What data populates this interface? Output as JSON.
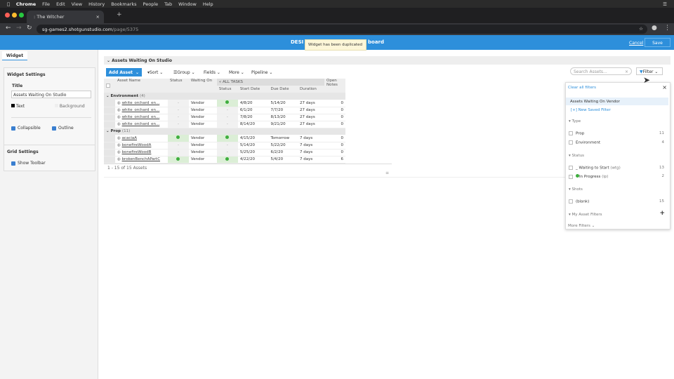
{
  "menubar": {
    "items": [
      "Chrome",
      "File",
      "Edit",
      "View",
      "History",
      "Bookmarks",
      "People",
      "Tab",
      "Window",
      "Help"
    ]
  },
  "browser": {
    "tab_title": ": The Witcher",
    "url_host": "sg-games2.shotgunstudio.com",
    "url_path": "/page/5375"
  },
  "topbar": {
    "title_left": "DESI",
    "title_right": "board",
    "cancel": "Cancel",
    "save": "Save"
  },
  "toast": "Widget has been duplicated",
  "left": {
    "tab": "Widget",
    "widget_settings": "Widget Settings",
    "title_label": "Title",
    "title_value": "Assets Waiting On Studio",
    "text": "Text",
    "background": "Background",
    "collapsible": "Collapsible",
    "outline": "Outline",
    "grid_settings": "Grid Settings",
    "show_toolbar": "Show Toolbar"
  },
  "widget": {
    "title": "Assets Waiting On Studio",
    "add_asset": "Add Asset",
    "sort": "Sort",
    "group": "Group",
    "fields": "Fields",
    "more": "More",
    "pipeline": "Pipeline",
    "search_placeholder": "Search Assets...",
    "filter": "Filter",
    "headers": {
      "asset_name": "Asset Name",
      "status": "Status",
      "waiting_on": "Waiting On",
      "all_tasks": "ALL TASKS",
      "task_status": "Status",
      "start_date": "Start Date",
      "due_date": "Due Date",
      "duration": "Duration",
      "open_notes": "Open Notes"
    },
    "groups": [
      {
        "name": "Environment",
        "count": "(4)",
        "rows": [
          {
            "name": "white_orchard_en...",
            "status": "-",
            "waiting": "Vendor",
            "task_status": "ip",
            "start": "4/8/20",
            "due": "5/14/20",
            "duration": "27 days",
            "notes": "0"
          },
          {
            "name": "white_orchard_en...",
            "status": "-",
            "waiting": "Vendor",
            "task_status": "-",
            "start": "6/1/20",
            "due": "7/7/20",
            "duration": "27 days",
            "notes": "0"
          },
          {
            "name": "white_orchard_en...",
            "status": "-",
            "waiting": "Vendor",
            "task_status": "-",
            "start": "7/8/20",
            "due": "8/13/20",
            "duration": "27 days",
            "notes": "0"
          },
          {
            "name": "white_orchard_en...",
            "status": "-",
            "waiting": "Vendor",
            "task_status": "-",
            "start": "8/14/20",
            "due": "9/21/20",
            "duration": "27 days",
            "notes": "0"
          }
        ]
      },
      {
        "name": "Prop",
        "count": "(11)",
        "rows": [
          {
            "name": "acaciaA",
            "status": "ip",
            "waiting": "Vendor",
            "task_status": "ip",
            "start": "4/15/20",
            "due": "Tomorrow",
            "duration": "7 days",
            "notes": "0"
          },
          {
            "name": "bonefireWoodA",
            "status": "-",
            "waiting": "Vendor",
            "task_status": "-",
            "start": "5/14/20",
            "due": "5/22/20",
            "duration": "7 days",
            "notes": "0"
          },
          {
            "name": "bonefireWoodB",
            "status": "-",
            "waiting": "Vendor",
            "task_status": "-",
            "start": "5/25/20",
            "due": "6/2/20",
            "duration": "7 days",
            "notes": "0"
          },
          {
            "name": "brokenBenchAPartC",
            "status": "ip",
            "waiting": "Vendor",
            "task_status": "ip",
            "start": "4/22/20",
            "due": "5/4/20",
            "duration": "7 days",
            "notes": "6"
          }
        ]
      }
    ],
    "footer": "1 - 15 of 15 Assets"
  },
  "filter_panel": {
    "clear": "Clear all filters",
    "saved": "Assets Waiting On Vendor",
    "new_saved": "[+] New Saved Filter",
    "type_label": "Type",
    "types": [
      {
        "label": "Prop",
        "count": "11"
      },
      {
        "label": "Environment",
        "count": "4"
      }
    ],
    "status_label": "Status",
    "statuses": [
      {
        "label": "Waiting to Start",
        "code": "(wtg)",
        "count": "13"
      },
      {
        "label": "In Progress",
        "code": "(ip)",
        "count": "2"
      }
    ],
    "shots_label": "Shots",
    "shots": [
      {
        "label": "(blank)",
        "count": "15"
      }
    ],
    "my_filters": "My Asset Filters",
    "more_filters": "More Filters"
  },
  "colors": {
    "accent": "#2d8fdb",
    "status_green": "#3eae3e"
  }
}
